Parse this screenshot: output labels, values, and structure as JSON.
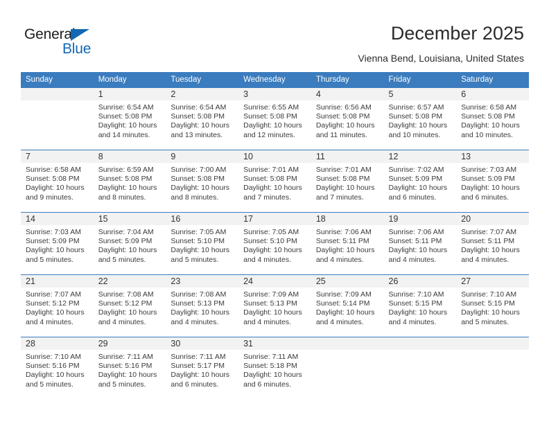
{
  "brand": {
    "name_part1": "General",
    "name_part2": "Blue",
    "accent_color": "#1268b3"
  },
  "header": {
    "title": "December 2025",
    "location": "Vienna Bend, Louisiana, United States"
  },
  "calendar": {
    "header_color": "#3a7cbe",
    "weekday_headers": [
      "Sunday",
      "Monday",
      "Tuesday",
      "Wednesday",
      "Thursday",
      "Friday",
      "Saturday"
    ],
    "weeks": [
      [
        {
          "day": "",
          "sunrise": "",
          "sunset": "",
          "daylight_line1": "",
          "daylight_line2": ""
        },
        {
          "day": "1",
          "sunrise": "Sunrise: 6:54 AM",
          "sunset": "Sunset: 5:08 PM",
          "daylight_line1": "Daylight: 10 hours",
          "daylight_line2": "and 14 minutes."
        },
        {
          "day": "2",
          "sunrise": "Sunrise: 6:54 AM",
          "sunset": "Sunset: 5:08 PM",
          "daylight_line1": "Daylight: 10 hours",
          "daylight_line2": "and 13 minutes."
        },
        {
          "day": "3",
          "sunrise": "Sunrise: 6:55 AM",
          "sunset": "Sunset: 5:08 PM",
          "daylight_line1": "Daylight: 10 hours",
          "daylight_line2": "and 12 minutes."
        },
        {
          "day": "4",
          "sunrise": "Sunrise: 6:56 AM",
          "sunset": "Sunset: 5:08 PM",
          "daylight_line1": "Daylight: 10 hours",
          "daylight_line2": "and 11 minutes."
        },
        {
          "day": "5",
          "sunrise": "Sunrise: 6:57 AM",
          "sunset": "Sunset: 5:08 PM",
          "daylight_line1": "Daylight: 10 hours",
          "daylight_line2": "and 10 minutes."
        },
        {
          "day": "6",
          "sunrise": "Sunrise: 6:58 AM",
          "sunset": "Sunset: 5:08 PM",
          "daylight_line1": "Daylight: 10 hours",
          "daylight_line2": "and 10 minutes."
        }
      ],
      [
        {
          "day": "7",
          "sunrise": "Sunrise: 6:58 AM",
          "sunset": "Sunset: 5:08 PM",
          "daylight_line1": "Daylight: 10 hours",
          "daylight_line2": "and 9 minutes."
        },
        {
          "day": "8",
          "sunrise": "Sunrise: 6:59 AM",
          "sunset": "Sunset: 5:08 PM",
          "daylight_line1": "Daylight: 10 hours",
          "daylight_line2": "and 8 minutes."
        },
        {
          "day": "9",
          "sunrise": "Sunrise: 7:00 AM",
          "sunset": "Sunset: 5:08 PM",
          "daylight_line1": "Daylight: 10 hours",
          "daylight_line2": "and 8 minutes."
        },
        {
          "day": "10",
          "sunrise": "Sunrise: 7:01 AM",
          "sunset": "Sunset: 5:08 PM",
          "daylight_line1": "Daylight: 10 hours",
          "daylight_line2": "and 7 minutes."
        },
        {
          "day": "11",
          "sunrise": "Sunrise: 7:01 AM",
          "sunset": "Sunset: 5:08 PM",
          "daylight_line1": "Daylight: 10 hours",
          "daylight_line2": "and 7 minutes."
        },
        {
          "day": "12",
          "sunrise": "Sunrise: 7:02 AM",
          "sunset": "Sunset: 5:09 PM",
          "daylight_line1": "Daylight: 10 hours",
          "daylight_line2": "and 6 minutes."
        },
        {
          "day": "13",
          "sunrise": "Sunrise: 7:03 AM",
          "sunset": "Sunset: 5:09 PM",
          "daylight_line1": "Daylight: 10 hours",
          "daylight_line2": "and 6 minutes."
        }
      ],
      [
        {
          "day": "14",
          "sunrise": "Sunrise: 7:03 AM",
          "sunset": "Sunset: 5:09 PM",
          "daylight_line1": "Daylight: 10 hours",
          "daylight_line2": "and 5 minutes."
        },
        {
          "day": "15",
          "sunrise": "Sunrise: 7:04 AM",
          "sunset": "Sunset: 5:09 PM",
          "daylight_line1": "Daylight: 10 hours",
          "daylight_line2": "and 5 minutes."
        },
        {
          "day": "16",
          "sunrise": "Sunrise: 7:05 AM",
          "sunset": "Sunset: 5:10 PM",
          "daylight_line1": "Daylight: 10 hours",
          "daylight_line2": "and 5 minutes."
        },
        {
          "day": "17",
          "sunrise": "Sunrise: 7:05 AM",
          "sunset": "Sunset: 5:10 PM",
          "daylight_line1": "Daylight: 10 hours",
          "daylight_line2": "and 4 minutes."
        },
        {
          "day": "18",
          "sunrise": "Sunrise: 7:06 AM",
          "sunset": "Sunset: 5:11 PM",
          "daylight_line1": "Daylight: 10 hours",
          "daylight_line2": "and 4 minutes."
        },
        {
          "day": "19",
          "sunrise": "Sunrise: 7:06 AM",
          "sunset": "Sunset: 5:11 PM",
          "daylight_line1": "Daylight: 10 hours",
          "daylight_line2": "and 4 minutes."
        },
        {
          "day": "20",
          "sunrise": "Sunrise: 7:07 AM",
          "sunset": "Sunset: 5:11 PM",
          "daylight_line1": "Daylight: 10 hours",
          "daylight_line2": "and 4 minutes."
        }
      ],
      [
        {
          "day": "21",
          "sunrise": "Sunrise: 7:07 AM",
          "sunset": "Sunset: 5:12 PM",
          "daylight_line1": "Daylight: 10 hours",
          "daylight_line2": "and 4 minutes."
        },
        {
          "day": "22",
          "sunrise": "Sunrise: 7:08 AM",
          "sunset": "Sunset: 5:12 PM",
          "daylight_line1": "Daylight: 10 hours",
          "daylight_line2": "and 4 minutes."
        },
        {
          "day": "23",
          "sunrise": "Sunrise: 7:08 AM",
          "sunset": "Sunset: 5:13 PM",
          "daylight_line1": "Daylight: 10 hours",
          "daylight_line2": "and 4 minutes."
        },
        {
          "day": "24",
          "sunrise": "Sunrise: 7:09 AM",
          "sunset": "Sunset: 5:13 PM",
          "daylight_line1": "Daylight: 10 hours",
          "daylight_line2": "and 4 minutes."
        },
        {
          "day": "25",
          "sunrise": "Sunrise: 7:09 AM",
          "sunset": "Sunset: 5:14 PM",
          "daylight_line1": "Daylight: 10 hours",
          "daylight_line2": "and 4 minutes."
        },
        {
          "day": "26",
          "sunrise": "Sunrise: 7:10 AM",
          "sunset": "Sunset: 5:15 PM",
          "daylight_line1": "Daylight: 10 hours",
          "daylight_line2": "and 4 minutes."
        },
        {
          "day": "27",
          "sunrise": "Sunrise: 7:10 AM",
          "sunset": "Sunset: 5:15 PM",
          "daylight_line1": "Daylight: 10 hours",
          "daylight_line2": "and 5 minutes."
        }
      ],
      [
        {
          "day": "28",
          "sunrise": "Sunrise: 7:10 AM",
          "sunset": "Sunset: 5:16 PM",
          "daylight_line1": "Daylight: 10 hours",
          "daylight_line2": "and 5 minutes."
        },
        {
          "day": "29",
          "sunrise": "Sunrise: 7:11 AM",
          "sunset": "Sunset: 5:16 PM",
          "daylight_line1": "Daylight: 10 hours",
          "daylight_line2": "and 5 minutes."
        },
        {
          "day": "30",
          "sunrise": "Sunrise: 7:11 AM",
          "sunset": "Sunset: 5:17 PM",
          "daylight_line1": "Daylight: 10 hours",
          "daylight_line2": "and 6 minutes."
        },
        {
          "day": "31",
          "sunrise": "Sunrise: 7:11 AM",
          "sunset": "Sunset: 5:18 PM",
          "daylight_line1": "Daylight: 10 hours",
          "daylight_line2": "and 6 minutes."
        },
        {
          "day": "",
          "sunrise": "",
          "sunset": "",
          "daylight_line1": "",
          "daylight_line2": ""
        },
        {
          "day": "",
          "sunrise": "",
          "sunset": "",
          "daylight_line1": "",
          "daylight_line2": ""
        },
        {
          "day": "",
          "sunrise": "",
          "sunset": "",
          "daylight_line1": "",
          "daylight_line2": ""
        }
      ]
    ]
  }
}
